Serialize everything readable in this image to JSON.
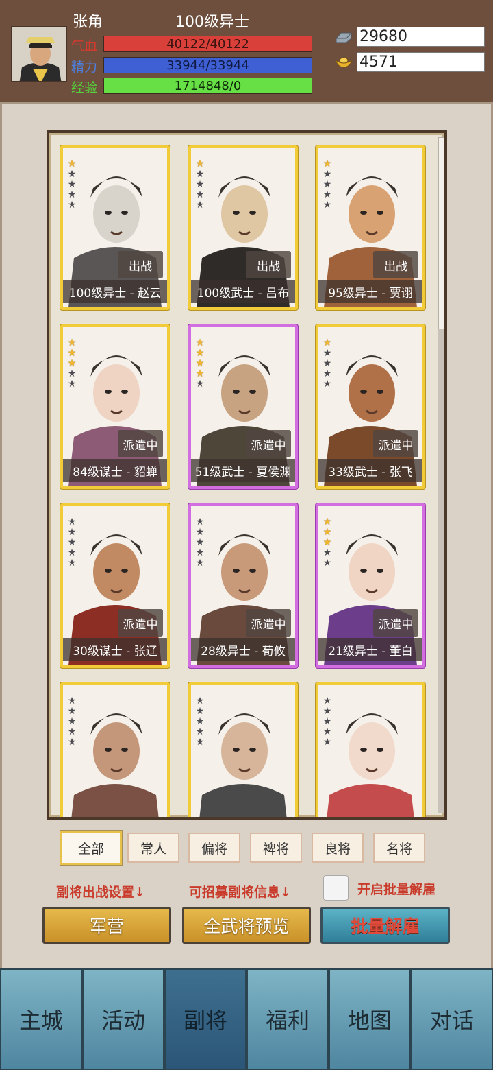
{
  "player": {
    "name": "张角",
    "title": "100级异士",
    "hp_label": "气血",
    "hp_value": "40122/40122",
    "mp_label": "精力",
    "mp_value": "33944/33944",
    "exp_label": "经验",
    "exp_value": "1714848/0",
    "label_colors": {
      "hp": "#d8392d",
      "mp": "#4d7fe0",
      "exp": "#55d13b"
    }
  },
  "resources": {
    "silver": "29680",
    "gold": "4571"
  },
  "cards": [
    {
      "label": "100级异士 - 赵云",
      "status": "出战",
      "stars": 1,
      "frame": "gold",
      "face": "#d8d4cc",
      "robe": "#5a5656"
    },
    {
      "label": "100级武士 - 吕布",
      "status": "出战",
      "stars": 1,
      "frame": "gold",
      "face": "#e0c7a4",
      "robe": "#2f2b28"
    },
    {
      "label": "95级异士 - 贾诩",
      "status": "出战",
      "stars": 1,
      "frame": "gold",
      "face": "#d9a272",
      "robe": "#a0623b"
    },
    {
      "label": "84级谋士 - 貂蝉",
      "status": "派遣中",
      "stars": 3,
      "frame": "gold",
      "face": "#efd3c3",
      "robe": "#8d5b75"
    },
    {
      "label": "51级武士 - 夏侯渊",
      "status": "派遣中",
      "stars": 4,
      "frame": "purple",
      "face": "#c7a382",
      "robe": "#4f463a"
    },
    {
      "label": "33级武士 - 张飞",
      "status": "派遣中",
      "stars": 1,
      "frame": "gold",
      "face": "#b07048",
      "robe": "#7a4a2a"
    },
    {
      "label": "30级谋士 - 张辽",
      "status": "派遣中",
      "stars": 0,
      "frame": "gold",
      "face": "#c18a62",
      "robe": "#8c2e23"
    },
    {
      "label": "28级异士 - 荀攸",
      "status": "派遣中",
      "stars": 0,
      "frame": "purple",
      "face": "#c89a7a",
      "robe": "#6a4a3c"
    },
    {
      "label": "21级异士 - 董白",
      "status": "派遣中",
      "stars": 3,
      "frame": "purple",
      "face": "#f0d4c4",
      "robe": "#6c3d8a"
    },
    {
      "label": "",
      "status": "",
      "stars": 0,
      "frame": "gold",
      "face": "#c4977a",
      "robe": "#7b5146"
    },
    {
      "label": "",
      "status": "",
      "stars": 0,
      "frame": "gold",
      "face": "#d7b59a",
      "robe": "#4a4a4a"
    },
    {
      "label": "",
      "status": "",
      "stars": 0,
      "frame": "gold",
      "face": "#f1d9cb",
      "robe": "#c44c4c"
    }
  ],
  "filters": [
    "全部",
    "常人",
    "偏将",
    "裨将",
    "良将",
    "名将"
  ],
  "hints": {
    "lineup": "副将出战设置↓",
    "recruit": "可招募副将信息↓",
    "batch_toggle": "开启批量解雇"
  },
  "buttons": {
    "camp": "军营",
    "preview": "全武将预览",
    "batch_dismiss": "批量解雇"
  },
  "nav": [
    "主城",
    "活动",
    "副将",
    "福利",
    "地图",
    "对话"
  ],
  "nav_active": 2
}
